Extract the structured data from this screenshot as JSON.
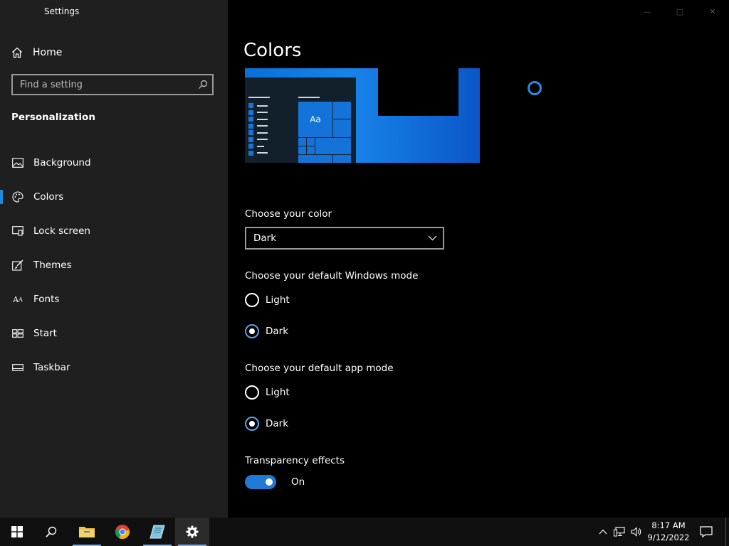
{
  "window": {
    "title": "Settings"
  },
  "sidebar": {
    "home_label": "Home",
    "search_placeholder": "Find a setting",
    "section_heading": "Personalization",
    "items": [
      {
        "label": "Background",
        "icon": "picture-icon"
      },
      {
        "label": "Colors",
        "icon": "palette-icon",
        "selected": true
      },
      {
        "label": "Lock screen",
        "icon": "lock-screen-icon"
      },
      {
        "label": "Themes",
        "icon": "brush-icon"
      },
      {
        "label": "Fonts",
        "icon": "fonts-icon"
      },
      {
        "label": "Start",
        "icon": "start-layout-icon"
      },
      {
        "label": "Taskbar",
        "icon": "taskbar-icon"
      }
    ]
  },
  "main": {
    "title": "Colors",
    "preview_sample_text": "Aa",
    "choose_color": {
      "label": "Choose your color",
      "selected": "Dark"
    },
    "windows_mode": {
      "label": "Choose your default Windows mode",
      "options": [
        "Light",
        "Dark"
      ],
      "selected": "Dark"
    },
    "app_mode": {
      "label": "Choose your default app mode",
      "options": [
        "Light",
        "Dark"
      ],
      "selected": "Dark"
    },
    "transparency": {
      "label": "Transparency effects",
      "state": "On"
    }
  },
  "taskbar": {
    "apps": [
      "start-icon",
      "search-icon",
      "file-explorer-icon",
      "chrome-icon",
      "notepad-icon",
      "settings-gear-icon"
    ],
    "clock": {
      "time": "8:17 AM",
      "date": "9/12/2022"
    }
  },
  "colors": {
    "accent": "#1f7ad6",
    "sidebar_bg": "#1f1f1f",
    "main_bg": "#000000",
    "taskbar_bg": "#101010"
  }
}
